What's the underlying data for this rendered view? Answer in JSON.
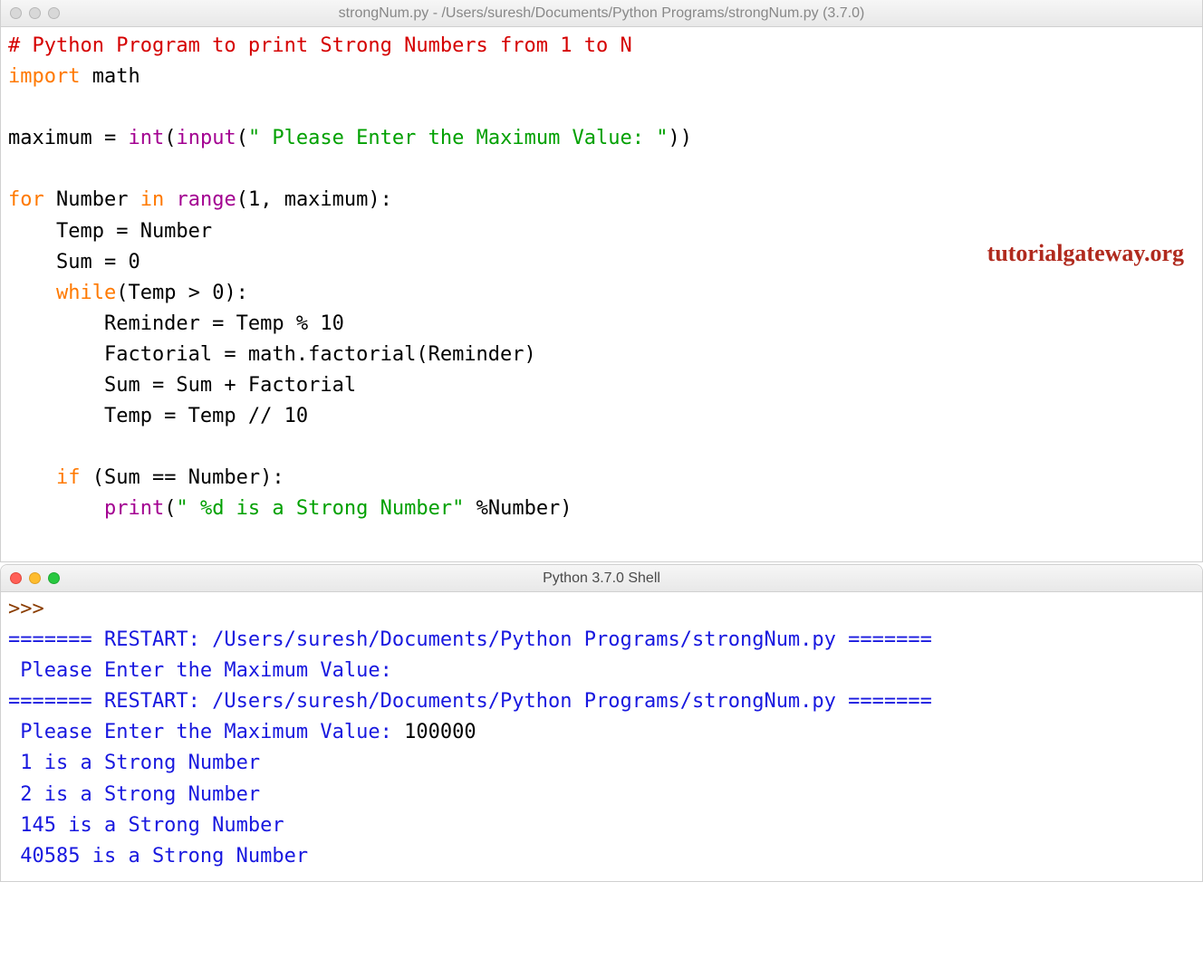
{
  "editorWindow": {
    "title": "strongNum.py - /Users/suresh/Documents/Python Programs/strongNum.py (3.7.0)"
  },
  "code": {
    "l1": "# Python Program to print Strong Numbers from 1 to N",
    "l2a": "import",
    "l2b": " math",
    "l3": "",
    "l4a": "maximum = ",
    "l4b": "int",
    "l4c": "(",
    "l4d": "input",
    "l4e": "(",
    "l4f": "\" Please Enter the Maximum Value: \"",
    "l4g": "))",
    "l5": "",
    "l6a": "for",
    "l6b": " Number ",
    "l6c": "in",
    "l6d": " ",
    "l6e": "range",
    "l6f": "(",
    "l6g": "1",
    "l6h": ", maximum):",
    "l7": "    Temp = Number",
    "l8a": "    Sum = ",
    "l8b": "0",
    "l9a": "    ",
    "l9b": "while",
    "l9c": "(Temp > ",
    "l9d": "0",
    "l9e": "):",
    "l10a": "        Reminder = Temp % ",
    "l10b": "10",
    "l11": "        Factorial = math.factorial(Reminder)",
    "l12": "        Sum = Sum + Factorial",
    "l13a": "        Temp = Temp // ",
    "l13b": "10",
    "l14": "",
    "l15a": "    ",
    "l15b": "if",
    "l15c": " (Sum == Number):",
    "l16a": "        ",
    "l16b": "print",
    "l16c": "(",
    "l16d": "\" %d is a Strong Number\"",
    "l16e": " %Number)"
  },
  "watermark": "tutorialgateway.org",
  "shellWindow": {
    "title": "Python 3.7.0 Shell"
  },
  "shell": {
    "prompt": ">>> ",
    "r1": "======= RESTART: /Users/suresh/Documents/Python Programs/strongNum.py =======",
    "r2": " Please Enter the Maximum Value: ",
    "r3": "======= RESTART: /Users/suresh/Documents/Python Programs/strongNum.py =======",
    "r4a": " Please Enter the Maximum Value: ",
    "r4b": "100000",
    "r5": " 1 is a Strong Number",
    "r6": " 2 is a Strong Number",
    "r7": " 145 is a Strong Number",
    "r8": " 40585 is a Strong Number"
  }
}
